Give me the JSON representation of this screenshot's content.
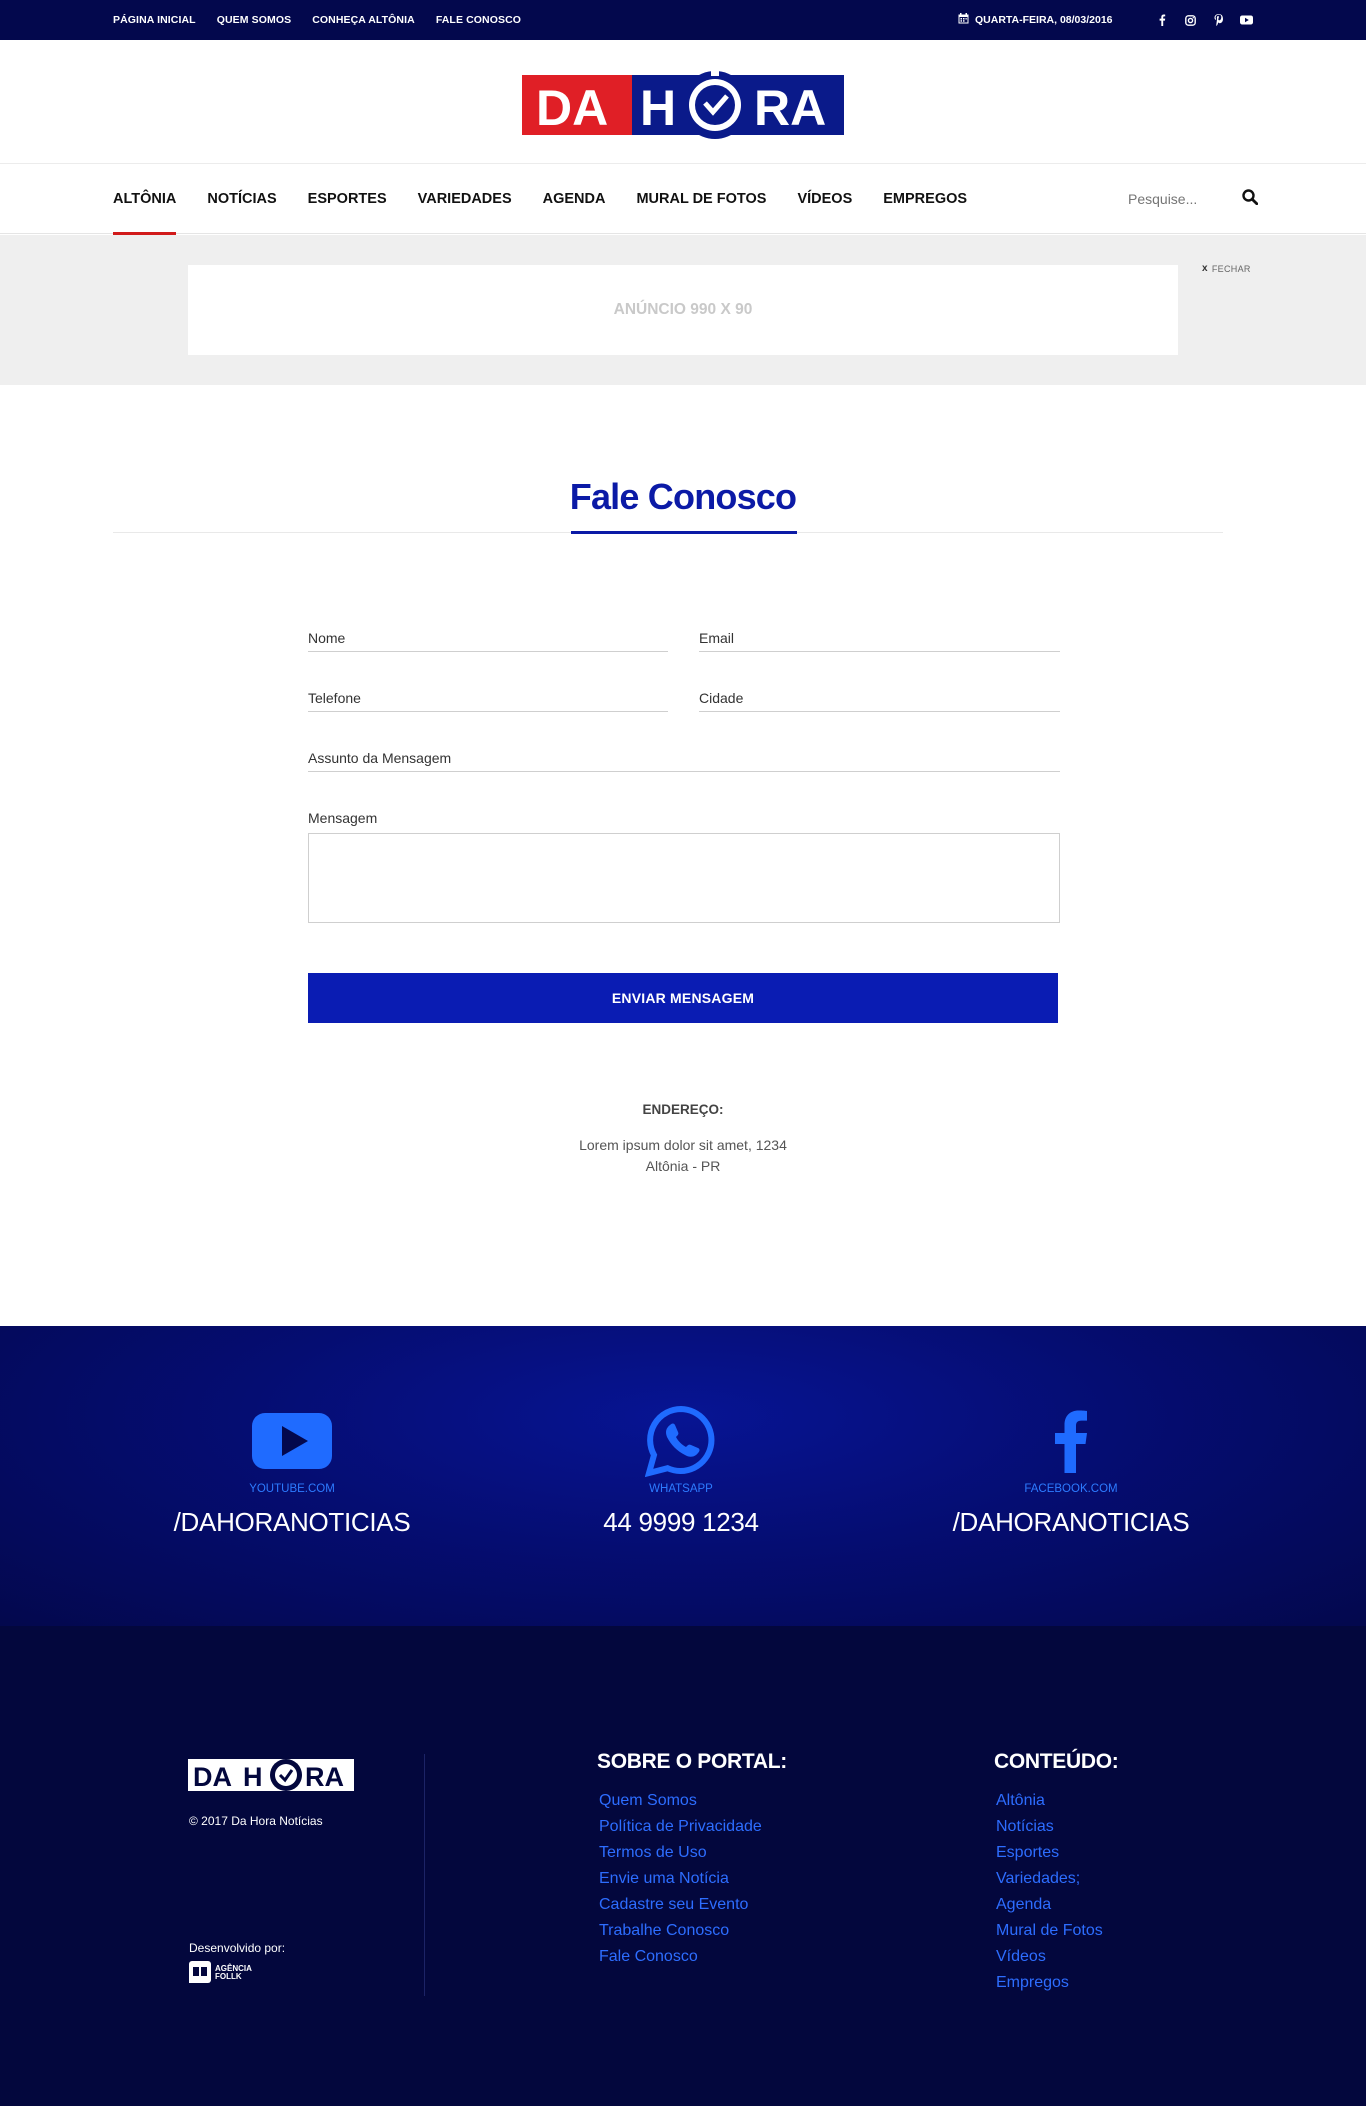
{
  "topbar": {
    "links": [
      "PÁGINA INICIAL",
      "QUEM SOMOS",
      "CONHEÇA ALTÔNIA",
      "FALE CONOSCO"
    ],
    "date": "QUARTA-FEIRA, 08/03/2016",
    "social_icons": [
      "facebook-icon",
      "instagram-icon",
      "pinterest-icon",
      "youtube-icon"
    ]
  },
  "logo": {
    "part1": "DA",
    "part2": "H",
    "part3": "RA",
    "red": "#e01f26",
    "blue": "#0a1a8a"
  },
  "menu": {
    "items": [
      "ALTÔNIA",
      "NOTÍCIAS",
      "ESPORTES",
      "VARIEDADES",
      "AGENDA",
      "MURAL DE FOTOS",
      "VÍDEOS",
      "EMPREGOS"
    ],
    "active": "ALTÔNIA",
    "search_placeholder": "Pesquise..."
  },
  "ad": {
    "label": "ANÚNCIO 990 X 90",
    "close": "FECHAR"
  },
  "page": {
    "title": "Fale Conosco"
  },
  "form": {
    "name_label": "Nome",
    "email_label": "Email",
    "phone_label": "Telefone",
    "city_label": "Cidade",
    "subject_label": "Assunto da Mensagem",
    "message_label": "Mensagem",
    "submit_label": "ENVIAR MENSAGEM"
  },
  "address": {
    "heading": "ENDEREÇO:",
    "line1": "Lorem ipsum dolor sit amet, 1234",
    "line2": "Altônia - PR"
  },
  "social_band": {
    "youtube": {
      "label": "YOUTUBE.COM",
      "value": "/DAHORANOTICIAS"
    },
    "whatsapp": {
      "label": "WHATSAPP",
      "value": "44 9999 1234"
    },
    "facebook": {
      "label": "FACEBOOK.COM",
      "value": "/DAHORANOTICIAS"
    },
    "icon_color": "#1f6bff"
  },
  "footer": {
    "copyright": "© 2017 Da Hora Notícias",
    "developed_by": "Desenvolvido por:",
    "agency_line1": "AGÊNCIA",
    "agency_line2": "FOLLK",
    "about_heading": "SOBRE O PORTAL:",
    "about_links": [
      "Quem Somos",
      "Política de Privacidade",
      "Termos de Uso",
      "Envie uma Notícia",
      "Cadastre seu Evento",
      "Trabalhe Conosco",
      "Fale Conosco"
    ],
    "content_heading": "CONTEÚDO:",
    "content_links": [
      "Altônia",
      "Notícias",
      "Esportes",
      "Variedades;",
      "Agenda",
      "Mural de Fotos",
      "Vídeos",
      "Empregos"
    ]
  }
}
